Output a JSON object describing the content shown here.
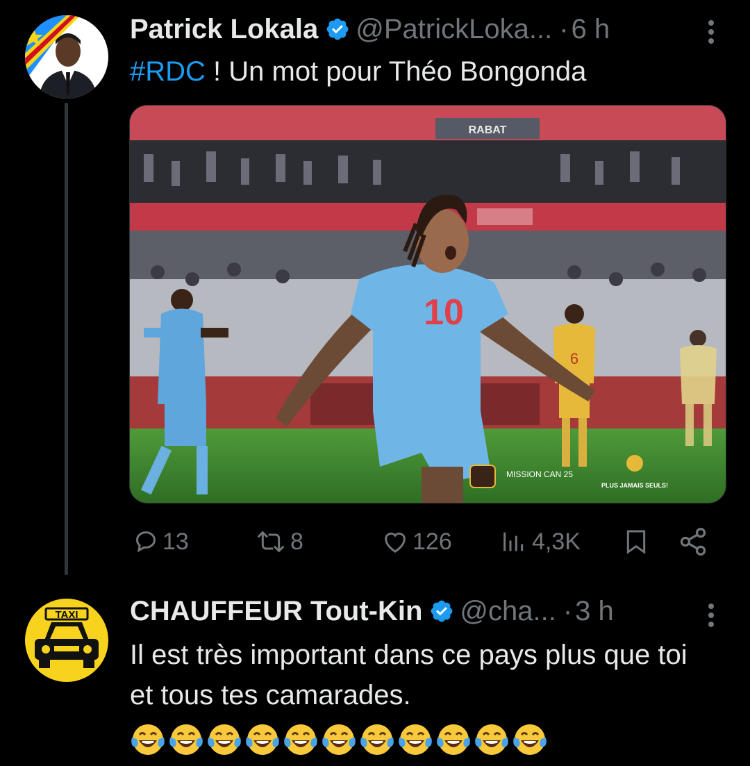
{
  "tweets": [
    {
      "author": "Patrick Lokala",
      "handle": "@PatrickLoka...",
      "dot": "·",
      "time": "6 h",
      "hashtag": "#RDC",
      "text": " ! Un mot pour Théo Bongonda",
      "media": {
        "banner_top": "RABAT",
        "jersey_number": "10",
        "sponsor_1": "MISSION CAN 25",
        "sponsor_2": "PLUS JAMAIS SEULS!"
      },
      "stats": {
        "replies": "13",
        "reposts": "8",
        "likes": "126",
        "views": "4,3K"
      },
      "avatar_icon": "profile-photo-icon"
    },
    {
      "author": "CHAUFFEUR Tout-Kin",
      "handle": "@cha...",
      "dot": "·",
      "time": "3 h",
      "text": "Il est très important dans ce pays plus que toi et tous tes camarades.",
      "emoji_count": 11,
      "avatar_label": "TAXI",
      "avatar_icon": "taxi-icon"
    }
  ],
  "colors": {
    "background": "#000000",
    "text": "#e7e9ea",
    "muted": "#71767b",
    "accent": "#1d9bf0",
    "verified": "#1d9bf0"
  }
}
